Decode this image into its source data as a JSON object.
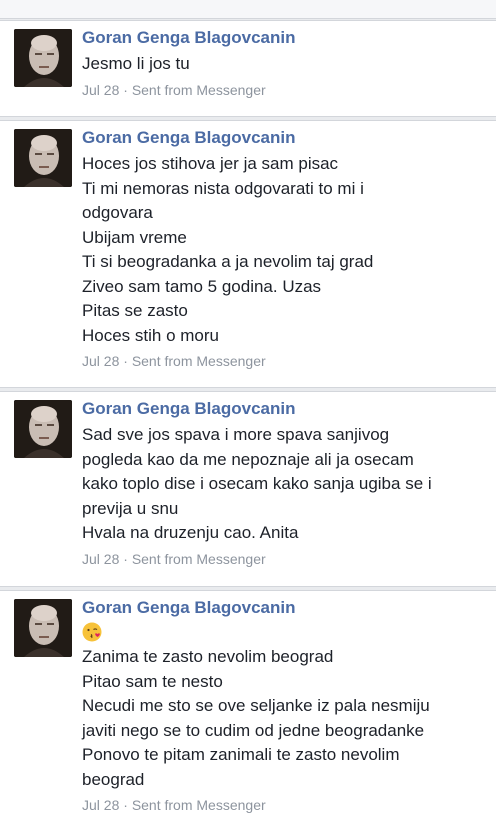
{
  "messages": [
    {
      "author": "Goran Genga Blagovcanin",
      "lines": [
        "Jesmo li jos tu"
      ],
      "date": "Jul 28",
      "separator": " · ",
      "source": "Sent from Messenger"
    },
    {
      "author": "Goran Genga Blagovcanin",
      "lines": [
        "Hoces jos stihova jer ja sam pisac",
        "Ti mi nemoras nista odgovarati to mi i",
        "odgovara",
        "Ubijam vreme",
        "Ti si beogradanka a ja nevolim taj grad",
        "Ziveo sam tamo 5 godina. Uzas",
        "Pitas se zasto",
        "Hoces stih o moru"
      ],
      "date": "Jul 28",
      "separator": " · ",
      "source": "Sent from Messenger"
    },
    {
      "author": "Goran Genga Blagovcanin",
      "lines": [
        "Sad sve jos spava i more spava sanjivog",
        "pogleda kao da me nepoznaje ali ja osecam",
        "kako toplo dise i osecam kako sanja ugiba se i",
        "previja u snu",
        "Hvala na druzenju cao. Anita"
      ],
      "date": "Jul 28",
      "separator": " · ",
      "source": "Sent from Messenger"
    },
    {
      "author": "Goran Genga Blagovcanin",
      "emoji": "kissing-face-emoji",
      "lines": [
        "Zanima te zasto nevolim beograd",
        "Pitao sam te nesto",
        "Necudi me sto se ove seljanke iz pala nesmiju",
        "javiti nego se to cudim od jedne beogradanke",
        "Ponovo te pitam zanimali te zasto nevolim",
        "beograd"
      ],
      "date": "Jul 28",
      "separator": " · ",
      "source": "Sent from Messenger"
    }
  ],
  "colors": {
    "author": "#4b6ba4",
    "text": "#1d2129",
    "meta": "#8d949e",
    "background": "#e9ebee",
    "card": "#ffffff"
  }
}
